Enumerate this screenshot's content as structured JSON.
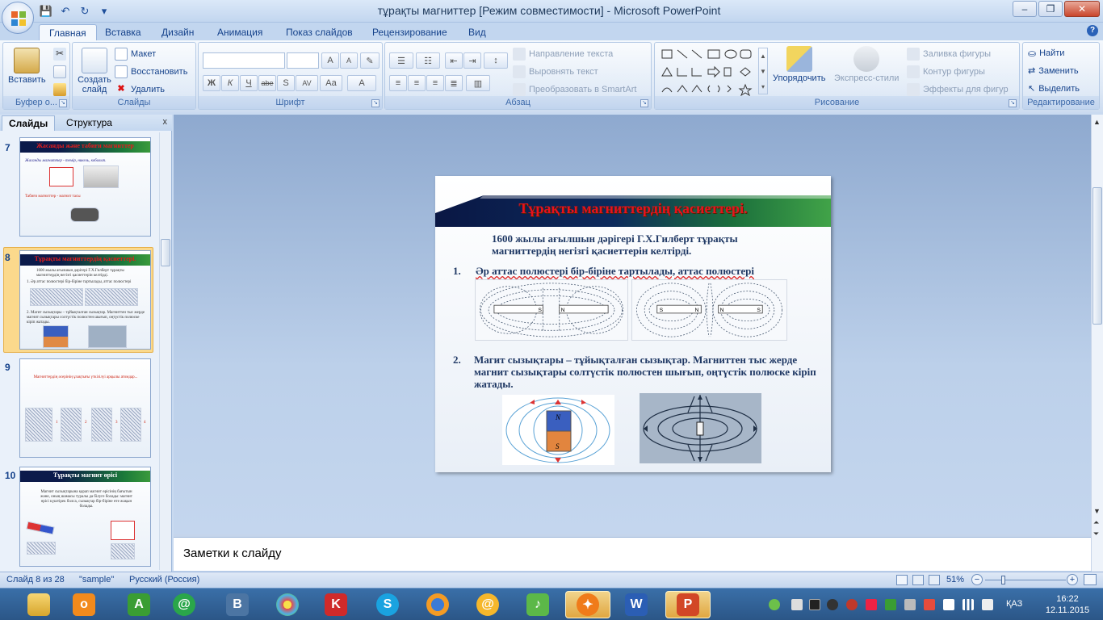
{
  "window": {
    "title": "тұрақты магниттер [Режим совместимости] - Microsoft PowerPoint",
    "minimize": "‒",
    "maximize": "❐",
    "close": "✕"
  },
  "qat": {
    "save": "💾",
    "undo": "↶",
    "redo": "↻",
    "more": "▾"
  },
  "tabs": [
    "Главная",
    "Вставка",
    "Дизайн",
    "Анимация",
    "Показ слайдов",
    "Рецензирование",
    "Вид"
  ],
  "help": "?",
  "ribbon": {
    "clipboard": {
      "paste": "Вставить",
      "group": "Буфер о..."
    },
    "slides": {
      "new_slide": "Создать слайд",
      "layout": "Макет",
      "reset": "Восстановить",
      "delete": "Удалить",
      "group": "Слайды"
    },
    "font": {
      "group": "Шрифт",
      "bold": "Ж",
      "italic": "К",
      "underline": "Ч",
      "strike": "abe",
      "shadow": "S",
      "spacing": "AV",
      "case": "Aa",
      "color": "A",
      "grow": "A",
      "shrink": "A"
    },
    "paragraph": {
      "text_direction": "Направление текста",
      "align_text": "Выровнять текст",
      "smartart": "Преобразовать в SmartArt",
      "group": "Абзац"
    },
    "drawing": {
      "arrange": "Упорядочить",
      "quick_styles": "Экспресс-стили",
      "fill": "Заливка фигуры",
      "outline": "Контур фигуры",
      "effects": "Эффекты для фигур",
      "group": "Рисование"
    },
    "editing": {
      "find": "Найти",
      "replace": "Заменить",
      "select": "Выделить",
      "group": "Редактирование"
    }
  },
  "left_panel": {
    "tab_slides": "Слайды",
    "tab_outline": "Структура",
    "close": "x",
    "thumbnails": [
      {
        "num": "7",
        "title": "Жасанды және табиғи магниттер",
        "line1": "Жасанды магниттер - темір, никель, кобальт.",
        "line2": "Табиғи магниттер - магнит тасы"
      },
      {
        "num": "8",
        "title": "Тұрақты магниттердің қасиеттері.",
        "line1": "1600 жылы ағылшын дәрігері Г.Х.Гилберт тұрақты магниттердің негізгі қасиеттерін келтірді.",
        "line2": "1. Әр аттас полюстері бір-біріне тартылады, аттас полюстері",
        "line3": "2. Магит сызықтары – тұйықталған сызықтар. Магниттен тыс жерде магнит сызықтары солтүстік полюстен шығып, оңтүстік полюске кіріп жатады."
      },
      {
        "num": "9",
        "title": "Магниттердің әсерінің ұзақтығы үткізілуі арқылы атомдар...",
        "labels": [
          "1",
          "2",
          "3",
          "4"
        ]
      },
      {
        "num": "10",
        "title": "Тұрақты магнит өрісі",
        "line1": "Магнит сызықтарына қарап магнит өрісінің бағытын және, оның шамасы туралы да білуге болады: магнит өрісі күштірек болса, сызықтар бір-біріне өте жақын болады."
      }
    ]
  },
  "slide": {
    "title": "Тұрақты магниттердің  қасиеттері.",
    "intro": "1600 жылы ағылшын дәрігері  Г.Х.Гилберт  тұрақты магниттердің  негізгі қасиеттерін  келтірді.",
    "item1_num": "1.",
    "item1": "Әр аттас  полюстері бір-біріне  тартылады, аттас  полюстері",
    "item2_num": "2.",
    "item2": "Магит сызықтары – тұйықталған сызықтар. Магниттен тыс жерде магнит сызықтары солтүстік полюстен шығып, оңтүстік полюске кіріп жатады.",
    "poles": {
      "s": "S",
      "n": "N"
    }
  },
  "notes": {
    "placeholder": "Заметки к слайду"
  },
  "status": {
    "slide": "Слайд 8 из 28",
    "theme": "\"sample\"",
    "language": "Русский (Россия)",
    "zoom": "51%",
    "zoom_minus": "−",
    "zoom_plus": "+"
  },
  "taskbar": {
    "lang": "ҚАЗ",
    "time": "16:22",
    "date": "12.11.2015"
  },
  "colors": {
    "title_red": "#e8121b",
    "body_navy": "#1f3864",
    "ribbon_blue": "#15428b",
    "selection": "#fbd98c"
  }
}
